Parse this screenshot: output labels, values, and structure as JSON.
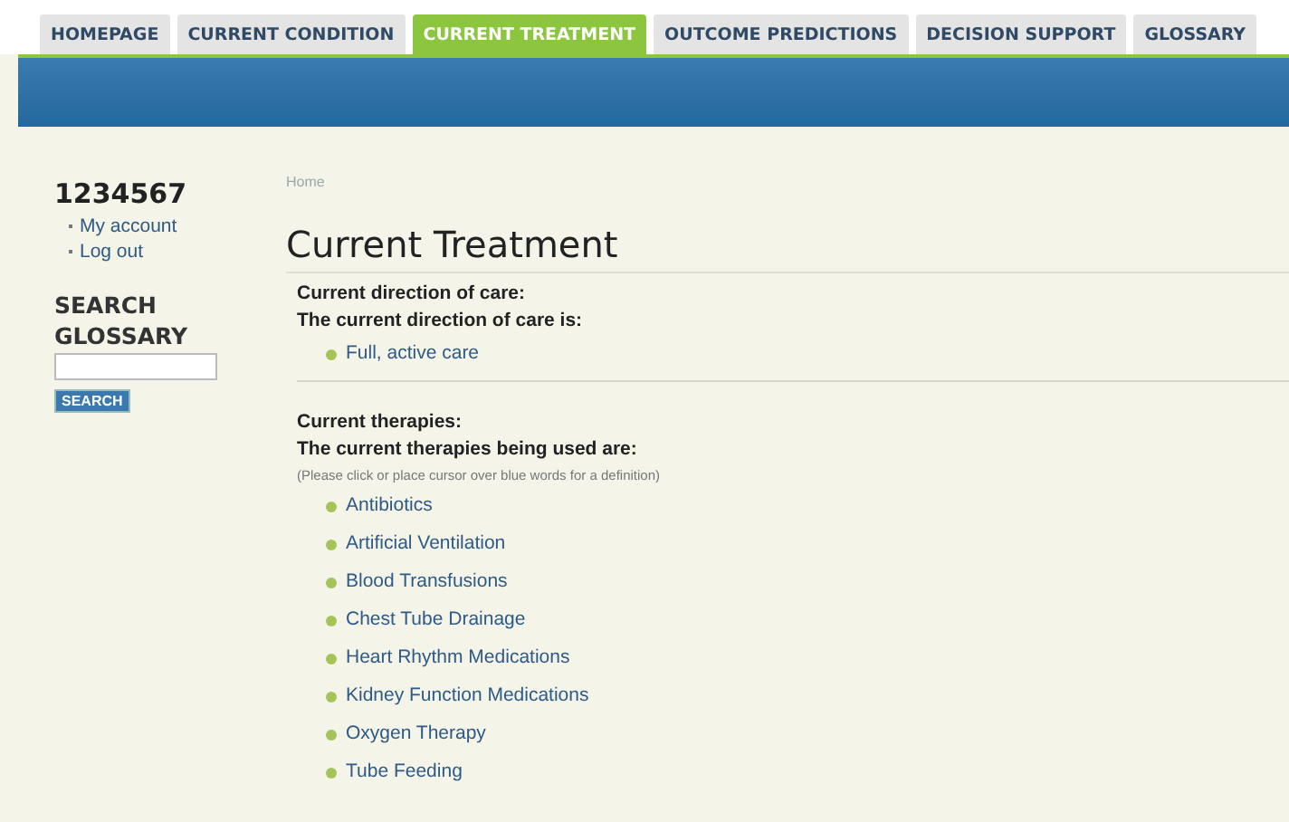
{
  "tabs": [
    {
      "label": "HOMEPAGE",
      "selected": false
    },
    {
      "label": "CURRENT CONDITION",
      "selected": false
    },
    {
      "label": "CURRENT TREATMENT",
      "selected": true
    },
    {
      "label": "OUTCOME PREDICTIONS",
      "selected": false
    },
    {
      "label": "DECISION SUPPORT",
      "selected": false
    },
    {
      "label": "GLOSSARY",
      "selected": false
    }
  ],
  "sidebar": {
    "user_id": "1234567",
    "links": [
      "My account",
      "Log out"
    ],
    "search_title": "SEARCH GLOSSARY",
    "search_button": "SEARCH"
  },
  "breadcrumb": "Home",
  "page_title": "Current Treatment",
  "sections": [
    {
      "heading": "Current direction of care:",
      "intro": "The current direction of care is:",
      "items": [
        "Full, active care"
      ]
    },
    {
      "heading": "Current therapies:",
      "intro": "The current therapies being used are:",
      "note": "(Please click or place cursor over blue words for a definition)",
      "items": [
        "Antibiotics",
        "Artificial Ventilation",
        "Blood Transfusions",
        "Chest Tube Drainage",
        "Heart Rhythm Medications",
        "Kidney Function Medications",
        "Oxygen Therapy",
        "Tube Feeding"
      ]
    }
  ]
}
